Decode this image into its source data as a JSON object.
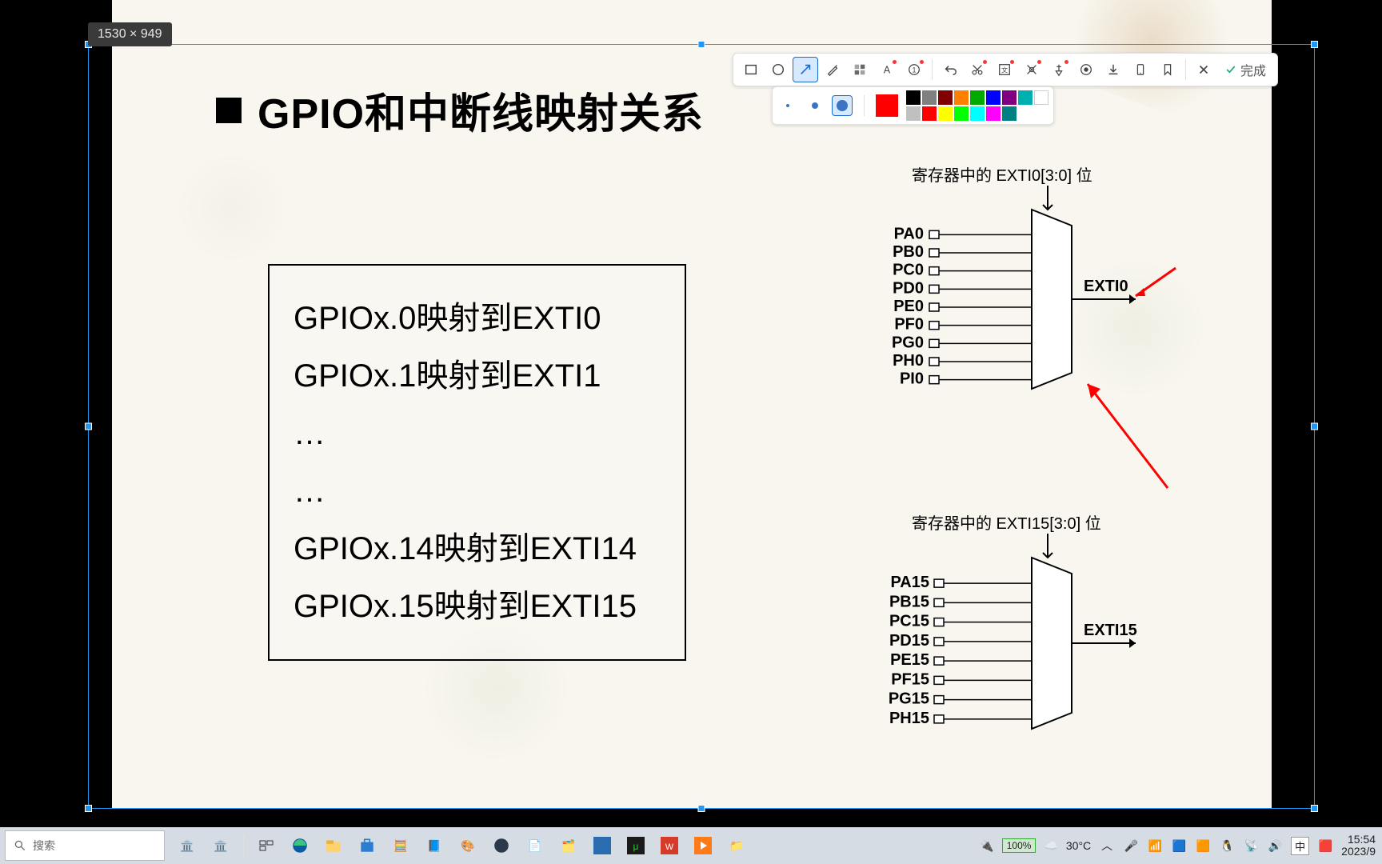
{
  "selection": {
    "dimensions_label": "1530 × 949"
  },
  "slide": {
    "title": "GPIO和中断线映射关系",
    "mappings": [
      "GPIOx.0映射到EXTI0",
      "GPIOx.1映射到EXTI1",
      "…",
      "…",
      "GPIOx.14映射到EXTI14",
      "GPIOx.15映射到EXTI15"
    ],
    "diagram0": {
      "caption": "寄存器中的 EXTI0[3:0] 位",
      "inputs": [
        "PA0",
        "PB0",
        "PC0",
        "PD0",
        "PE0",
        "PF0",
        "PG0",
        "PH0",
        "PI0"
      ],
      "output": "EXTI0"
    },
    "diagram15": {
      "caption": "寄存器中的 EXTI15[3:0] 位",
      "inputs": [
        "PA15",
        "PB15",
        "PC15",
        "PD15",
        "PE15",
        "PF15",
        "PG15",
        "PH15"
      ],
      "output": "EXTI15"
    }
  },
  "toolbar": {
    "done_label": "完成",
    "stroke_selected": "large",
    "color_selected": "#ff0000",
    "palette_row1": [
      "#000000",
      "#808080",
      "#800000",
      "#ff8000",
      "#00aa00",
      "#0000ff",
      "#800080",
      "#00b0b0"
    ],
    "palette_row2": [
      "#ffffff",
      "#c0c0c0",
      "#ff0000",
      "#ffff00",
      "#00ff00",
      "#00ffff",
      "#ff00ff",
      "#008080"
    ]
  },
  "taskbar": {
    "search_placeholder": "搜索",
    "battery": "100%",
    "weather": "30°C",
    "ime": "中",
    "time": "15:54",
    "date": "2023/9"
  }
}
